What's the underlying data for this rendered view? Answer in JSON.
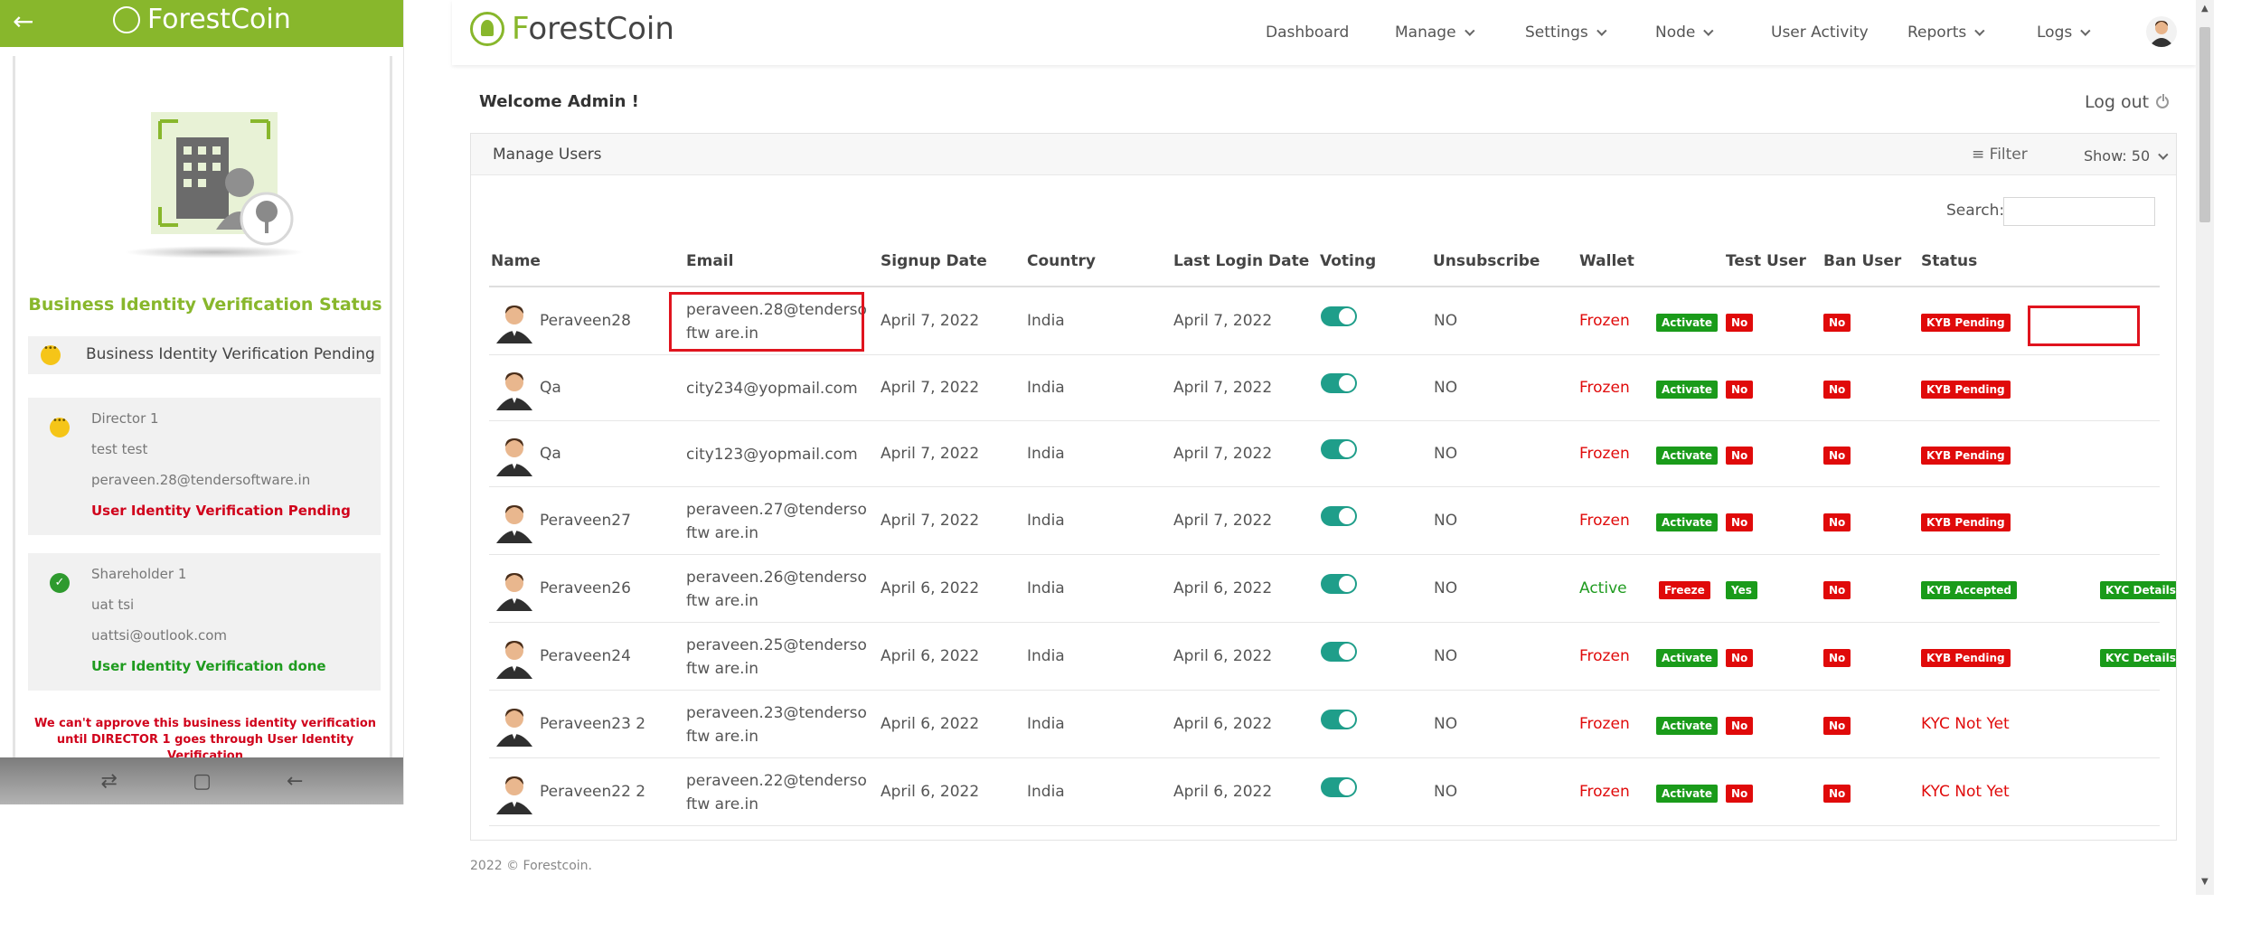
{
  "phone": {
    "back_icon": "arrow-left-icon",
    "brand": "ForestCoin",
    "status_title": "Business Identity Verification Status",
    "pending_label": "Business Identity Verification Pending",
    "director": {
      "title": "Director 1",
      "name": "test test",
      "email": "peraveen.28@tendersoftware.in",
      "status": "User Identity Verification Pending"
    },
    "shareholder": {
      "title": "Shareholder 1",
      "name": "uat tsi",
      "email": "uattsi@outlook.com",
      "status": "User Identity Verification done"
    },
    "warning": "We can't approve this business identity verification until DIRECTOR 1 goes through User Identity Verification",
    "nav_icons": [
      "recent-apps-icon",
      "home-icon",
      "back-icon"
    ]
  },
  "topnav": {
    "brand_prefix": "F",
    "brand_rest": "orestCoin",
    "items": [
      "Dashboard",
      "Manage",
      "Settings",
      "Node",
      "User Activity",
      "Reports",
      "Logs"
    ]
  },
  "main": {
    "welcome": "Welcome Admin !",
    "logout": "Log out",
    "panel_title": "Manage Users",
    "filter": "Filter",
    "show": "Show: 50",
    "search_label": "Search:",
    "search_value": "",
    "columns": [
      "Name",
      "Email",
      "Signup Date",
      "Country",
      "Last Login Date",
      "Voting",
      "Unsubscribe",
      "Wallet",
      "Test User",
      "Ban User",
      "Status"
    ],
    "rows": [
      {
        "name": "Peraveen28",
        "email": "peraveen.28@tendersoftw are.in",
        "signup": "April 7, 2022",
        "country": "India",
        "last_login": "April 7, 2022",
        "voting": true,
        "unsubscribe": "NO",
        "wallet": "Frozen",
        "wallet_action": "Activate",
        "test_user": "No",
        "ban_user": "No",
        "status": "KYB Pending",
        "kyc_details": ""
      },
      {
        "name": "Qa",
        "email": "city234@yopmail.com",
        "signup": "April 7, 2022",
        "country": "India",
        "last_login": "April 7, 2022",
        "voting": true,
        "unsubscribe": "NO",
        "wallet": "Frozen",
        "wallet_action": "Activate",
        "test_user": "No",
        "ban_user": "No",
        "status": "KYB Pending",
        "kyc_details": ""
      },
      {
        "name": "Qa",
        "email": "city123@yopmail.com",
        "signup": "April 7, 2022",
        "country": "India",
        "last_login": "April 7, 2022",
        "voting": true,
        "unsubscribe": "NO",
        "wallet": "Frozen",
        "wallet_action": "Activate",
        "test_user": "No",
        "ban_user": "No",
        "status": "KYB Pending",
        "kyc_details": ""
      },
      {
        "name": "Peraveen27",
        "email": "peraveen.27@tendersoftw are.in",
        "signup": "April 7, 2022",
        "country": "India",
        "last_login": "April 7, 2022",
        "voting": true,
        "unsubscribe": "NO",
        "wallet": "Frozen",
        "wallet_action": "Activate",
        "test_user": "No",
        "ban_user": "No",
        "status": "KYB Pending",
        "kyc_details": ""
      },
      {
        "name": "Peraveen26",
        "email": "peraveen.26@tendersoftw are.in",
        "signup": "April 6, 2022",
        "country": "India",
        "last_login": "April 6, 2022",
        "voting": true,
        "unsubscribe": "NO",
        "wallet": "Active",
        "wallet_action": "Freeze",
        "test_user": "Yes",
        "ban_user": "No",
        "status": "KYB Accepted",
        "kyc_details": "KYC Details"
      },
      {
        "name": "Peraveen24",
        "email": "peraveen.25@tendersoftw are.in",
        "signup": "April 6, 2022",
        "country": "India",
        "last_login": "April 6, 2022",
        "voting": true,
        "unsubscribe": "NO",
        "wallet": "Frozen",
        "wallet_action": "Activate",
        "test_user": "No",
        "ban_user": "No",
        "status": "KYB Pending",
        "kyc_details": "KYC Details"
      },
      {
        "name": "Peraveen23 2",
        "email": "peraveen.23@tendersoftw are.in",
        "signup": "April 6, 2022",
        "country": "India",
        "last_login": "April 6, 2022",
        "voting": true,
        "unsubscribe": "NO",
        "wallet": "Frozen",
        "wallet_action": "Activate",
        "test_user": "No",
        "ban_user": "No",
        "status": "KYC Not Yet",
        "kyc_details": ""
      },
      {
        "name": "Peraveen22 2",
        "email": "peraveen.22@tendersoftw are.in",
        "signup": "April 6, 2022",
        "country": "India",
        "last_login": "April 6, 2022",
        "voting": true,
        "unsubscribe": "NO",
        "wallet": "Frozen",
        "wallet_action": "Activate",
        "test_user": "No",
        "ban_user": "No",
        "status": "KYC Not Yet",
        "kyc_details": ""
      }
    ]
  },
  "footer": "2022 © Forestcoin.",
  "colors": {
    "brand_green": "#88b72c",
    "danger": "#e00a0a",
    "success": "#1a9b1a",
    "toggle": "#1f9e8a"
  }
}
